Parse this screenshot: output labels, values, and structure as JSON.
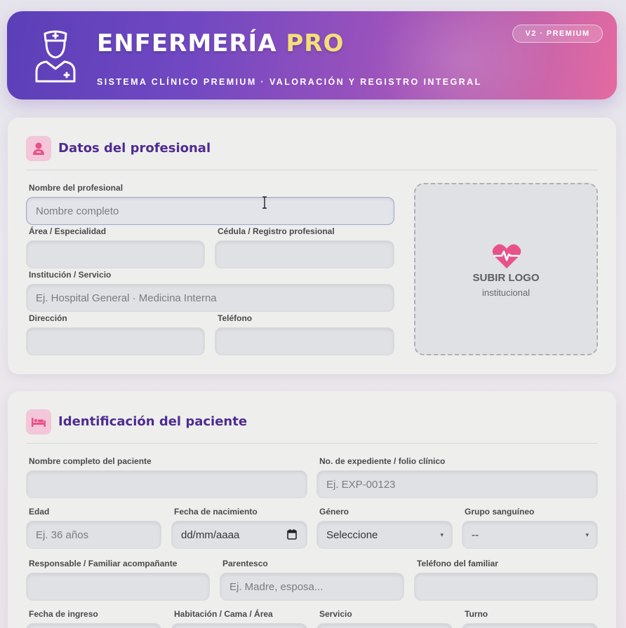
{
  "header": {
    "title_main": "ENFERMERÍA",
    "title_accent": "PRO",
    "subtitle": "SISTEMA CLÍNICO PREMIUM · VALORACIÓN Y REGISTRO INTEGRAL",
    "badge": "V2 · PREMIUM",
    "icon": "nurse-icon"
  },
  "profesional": {
    "title": "Datos del profesional",
    "icon": "doctor-icon",
    "nombre": {
      "label": "Nombre del profesional",
      "placeholder": "Nombre completo",
      "value": ""
    },
    "area": {
      "label": "Área / Especialidad",
      "value": ""
    },
    "cedula": {
      "label": "Cédula / Registro profesional",
      "value": ""
    },
    "institucion": {
      "label": "Institución / Servicio",
      "placeholder": "Ej. Hospital General · Medicina Interna",
      "value": ""
    },
    "direccion": {
      "label": "Dirección",
      "value": ""
    },
    "telefono": {
      "label": "Teléfono",
      "value": ""
    },
    "logo": {
      "title": "SUBIR LOGO",
      "subtitle": "institucional",
      "icon": "heart-pulse-icon"
    }
  },
  "paciente": {
    "title": "Identificación del paciente",
    "icon": "bed-icon",
    "nombre": {
      "label": "Nombre completo del paciente",
      "value": ""
    },
    "expediente": {
      "label": "No. de expediente / folio clínico",
      "placeholder": "Ej. EXP-00123"
    },
    "edad": {
      "label": "Edad",
      "placeholder": "Ej. 36 años"
    },
    "fecha_nacimiento": {
      "label": "Fecha de nacimiento",
      "value": "dd/mm/aaaa"
    },
    "genero": {
      "label": "Género",
      "value": "Seleccione"
    },
    "grupo": {
      "label": "Grupo sanguíneo",
      "value": "--"
    },
    "responsable": {
      "label": "Responsable / Familiar acompañante",
      "value": ""
    },
    "parentesco": {
      "label": "Parentesco",
      "placeholder": "Ej. Madre, esposa..."
    },
    "telefono_familiar": {
      "label": "Teléfono del familiar",
      "value": ""
    },
    "fecha_ingreso": {
      "label": "Fecha de ingreso"
    },
    "habitacion": {
      "label": "Habitación / Cama / Área"
    },
    "servicio": {
      "label": "Servicio"
    },
    "turno": {
      "label": "Turno"
    }
  },
  "colors": {
    "accent_purple": "#4e2c91",
    "accent_pink": "#e8528a",
    "header_gradient_start": "#5b3fb8",
    "header_gradient_end": "#e46aa0",
    "title_accent": "#f2df7a"
  }
}
